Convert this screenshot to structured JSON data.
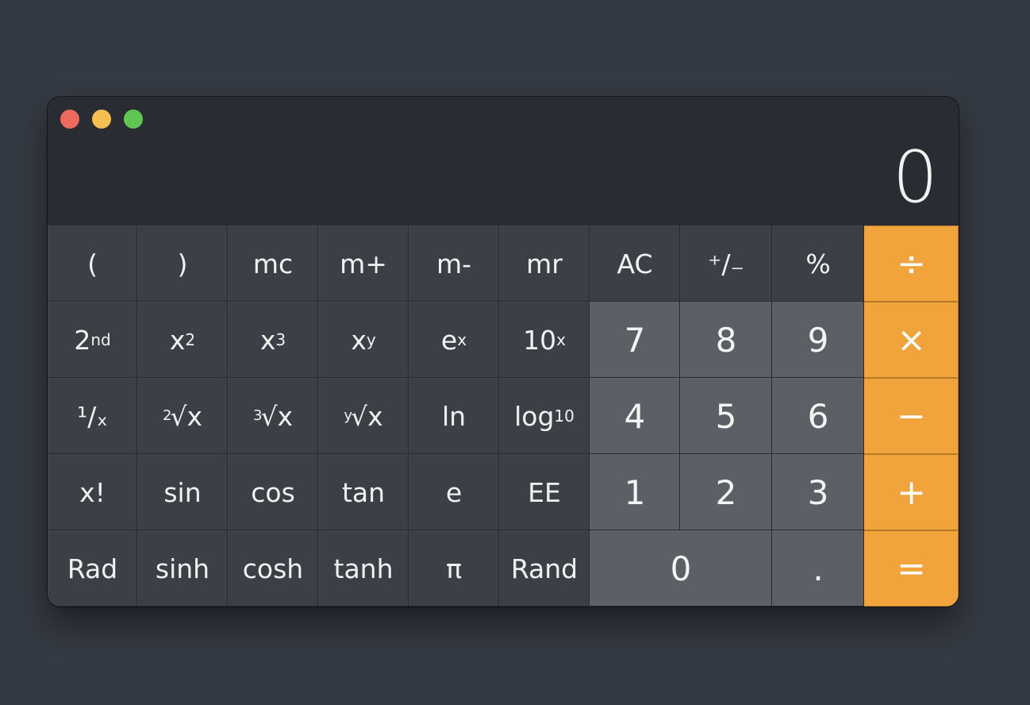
{
  "window": {
    "traffic_lights": {
      "close_color": "#ed6a5e",
      "minimize_color": "#f5bf4f",
      "zoom_color": "#61c554"
    }
  },
  "display": {
    "value": "0"
  },
  "colors": {
    "operator": "#f1a33c",
    "number_key": "#5c5f66",
    "function_key": "#3c4046",
    "background": "#343a43"
  },
  "keys": {
    "open_paren": "(",
    "close_paren": ")",
    "mc": "mc",
    "m_plus": "m+",
    "m_minus": "m-",
    "mr": "mr",
    "ac": "AC",
    "plus_minus": "⁺∕₋",
    "percent": "%",
    "divide": "÷",
    "second": {
      "base": "2",
      "sup": "nd"
    },
    "x_squared": {
      "base": "x",
      "sup": "2"
    },
    "x_cubed": {
      "base": "x",
      "sup": "3"
    },
    "x_pow_y": {
      "base": "x",
      "sup": "y"
    },
    "e_pow_x": {
      "base": "e",
      "sup": "x"
    },
    "ten_pow_x": {
      "base": "10",
      "sup": "x"
    },
    "seven": "7",
    "eight": "8",
    "nine": "9",
    "multiply": "×",
    "reciprocal": "¹∕ₓ",
    "sqrt": {
      "index": "2",
      "body": "√x"
    },
    "cbrt": {
      "index": "3",
      "body": "√x"
    },
    "yroot": {
      "index": "y",
      "body": "√x"
    },
    "ln": "ln",
    "log10": {
      "base": "log",
      "sub": "10"
    },
    "four": "4",
    "five": "5",
    "six": "6",
    "minus": "−",
    "factorial": "x!",
    "sin": "sin",
    "cos": "cos",
    "tan": "tan",
    "e": "e",
    "ee": "EE",
    "one": "1",
    "two": "2",
    "three": "3",
    "plus": "+",
    "rad": "Rad",
    "sinh": "sinh",
    "cosh": "cosh",
    "tanh": "tanh",
    "pi": "π",
    "rand": "Rand",
    "zero": "0",
    "decimal": ".",
    "equals": "="
  }
}
